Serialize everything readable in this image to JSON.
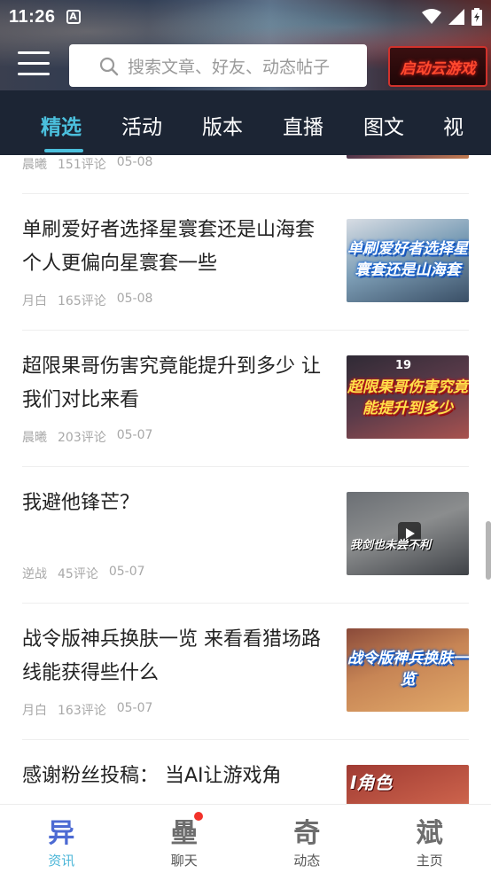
{
  "status_bar": {
    "time": "11:26",
    "app_badge": "A"
  },
  "header": {
    "search_placeholder": "搜索文章、好友、动态帖子",
    "launch_button": "启动云游戏",
    "tabs": [
      "精选",
      "活动",
      "版本",
      "直播",
      "图文",
      "视"
    ],
    "active_tab": "精选"
  },
  "feed": {
    "partial_item": {
      "author": "晨曦",
      "comments": "151评论",
      "date": "05-08"
    },
    "items": [
      {
        "title": "单刷爱好者选择星寰套还是山海套 个人更偏向星寰套一些",
        "author": "月白",
        "comments": "165评论",
        "date": "05-08",
        "thumb_text": "单刷爱好者选择星寰套还是山海套"
      },
      {
        "title": "超限果哥伤害究竟能提升到多少 让我们对比来看",
        "author": "晨曦",
        "comments": "203评论",
        "date": "05-07",
        "thumb_text": "超限果哥伤害究竟能提升到多少",
        "thumb_number": "19"
      },
      {
        "title": "我避他锋芒？",
        "author": "逆战",
        "comments": "45评论",
        "date": "05-07",
        "thumb_text": "我剑也未尝不利"
      },
      {
        "title": "战令版神兵换肤一览 来看看猎场路线能获得些什么",
        "author": "月白",
        "comments": "163评论",
        "date": "05-07",
        "thumb_text": "战令版神兵换肤一览"
      },
      {
        "title": "感谢粉丝投稿： 当AI让游戏角",
        "thumb_text": "I角色"
      }
    ]
  },
  "bottom_nav": {
    "items": [
      {
        "label": "资讯",
        "glyph": "异"
      },
      {
        "label": "聊天",
        "glyph": "壘"
      },
      {
        "label": "动态",
        "glyph": "奇"
      },
      {
        "label": "主页",
        "glyph": "斌"
      }
    ],
    "active": "资讯"
  },
  "colors": {
    "accent": "#4bc0dd",
    "tab_bar": "#1c2534",
    "badge": "#f2322a"
  }
}
